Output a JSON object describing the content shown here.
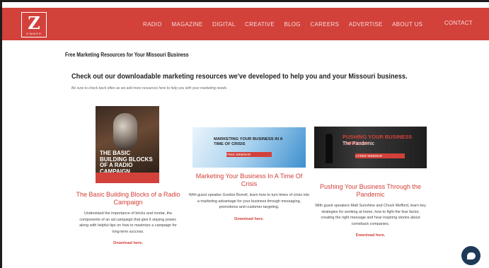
{
  "navbar": {
    "logo_letter": "Z",
    "logo_word": "ZIMMER",
    "items": [
      "RADIO",
      "MAGAZINE",
      "DIGITAL",
      "CREATIVE",
      "BLOG",
      "CAREERS",
      "ADVERTISE",
      "ABOUT US"
    ],
    "contact": "CONTACT",
    "color": "#d2413a"
  },
  "page": {
    "heading": "Free Marketing Resources for Your Missouri Business",
    "intro_title": "Check out our downloadable marketing resources we've developed to help you and your Missouri business.",
    "intro_note": "Be sure to check back often as we add more resources here to help you with your marketing needs."
  },
  "cards": [
    {
      "image_text": "THE BASIC BUILDING BLOCKS OF A RADIO CAMPAIGN",
      "title": "The Basic Building Blocks of a Radio Campaign",
      "desc": "Understand the importance of bricks and mortar, the components of an ad campaign that give it staying power, along with helpful tips on how to maximize a campaign for long-term success.",
      "download": "Download here."
    },
    {
      "image_text": "MARKETING YOUR BUSINESS IN A TIME OF CRISIS",
      "image_badge": "FREE WEBINAR",
      "title": "Marketing Your Business In A Time Of Crisis",
      "desc": "With guest speaker Gordon Borrell, learn how to turn times of crisis into a marketing advantage for your business through messaging, promotions and customer targeting.",
      "download": "Download here."
    },
    {
      "image_text": "PUSHING YOUR BUSINESS THROUGH",
      "image_subtext": "The Pandemic",
      "image_badge": "A FREE WEBINAR",
      "title": "Pushing Your Business Through the Pandemic",
      "desc": "With guest speakers Matt Sunshine and Chuck Mefford, learn key strategies for working at home, how to fight the fear factor, creating the right message and hear inspiring stories about comeback companies.",
      "download": "Download here."
    }
  ]
}
